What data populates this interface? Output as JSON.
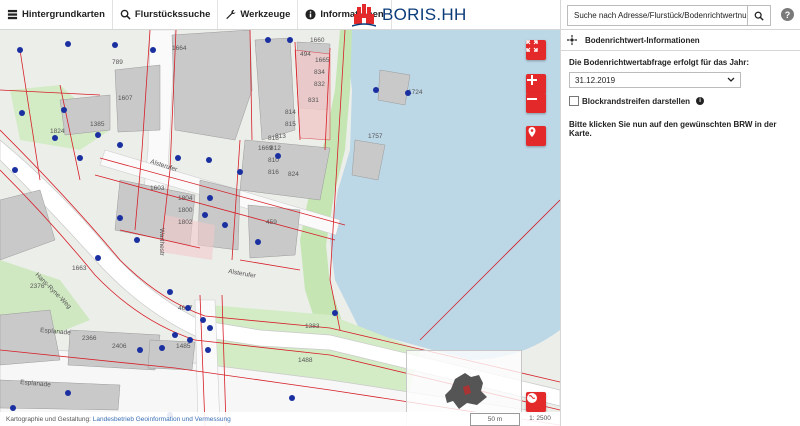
{
  "menu": {
    "items": [
      {
        "label": "Hintergrundkarten",
        "icon": "layers-icon"
      },
      {
        "label": "Flurstückssuche",
        "icon": "search-icon"
      },
      {
        "label": "Werkzeuge",
        "icon": "wrench-icon"
      },
      {
        "label": "Informationen",
        "icon": "info-icon"
      }
    ]
  },
  "brand": {
    "title": "BORIS.HH"
  },
  "search": {
    "placeholder": "Suche nach Adresse/Flurstück/Bodenrichtwertnumme"
  },
  "panel": {
    "title": "Bodenrichtwert-Informationen",
    "year_label": "Die Bodenrichtwertabfrage erfolgt für das Jahr:",
    "year_value": "31.12.2019",
    "checkbox_label": "Blockrandstreifen darstellen",
    "hint": "Bitte klicken Sie nun auf den gewünschten BRW in der Karte."
  },
  "footer": {
    "copyright_prefix": "Kartographie und Gestaltung: ",
    "copyright_link": "Landesbetrieb Geoinformation und Vermessung",
    "scale": "50 m",
    "ratio": "1: 2500"
  },
  "map_labels": [
    "1664",
    "789",
    "1607",
    "1669",
    "1603",
    "1824",
    "1724",
    "1757",
    "1663",
    "1665",
    "2376",
    "2366",
    "2406",
    "1485",
    "1488",
    "1383",
    "1385",
    "1804",
    "1800",
    "1802",
    "494",
    "834",
    "832",
    "831",
    "814",
    "815",
    "813",
    "812",
    "818",
    "810",
    "816",
    "824",
    "459",
    "4607",
    "1660",
    "Alsterufer",
    "Warthestr",
    "Hans-Ryne-Weg",
    "Esplanade",
    "Esplanade"
  ],
  "colors": {
    "accent": "#e4292b",
    "water": "#bcd7e6",
    "parcel_line": "#d61f28",
    "marker": "#1a2fa0",
    "building": "#c9c9c9",
    "green": "#c5e6b3"
  }
}
